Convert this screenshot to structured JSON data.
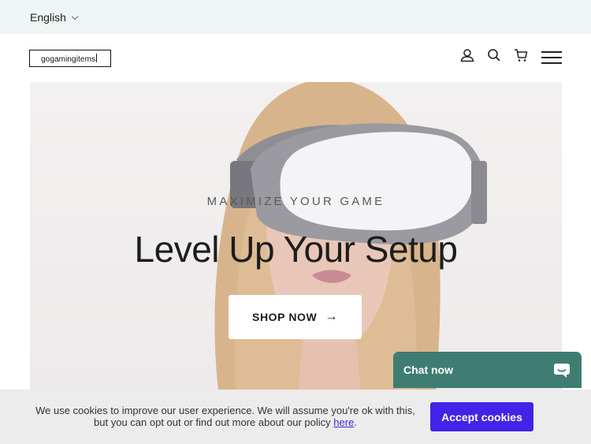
{
  "topbar": {
    "language": "English"
  },
  "header": {
    "logo_text": "gogamingitems",
    "icons": [
      "account-icon",
      "search-icon",
      "cart-icon",
      "menu-icon"
    ]
  },
  "hero": {
    "kicker": "MAXIMIZE YOUR GAME",
    "headline": "Level Up Your Setup",
    "cta_label": "SHOP NOW",
    "cta_icon": "arrow-right-icon",
    "arrow_glyph": "→"
  },
  "chat": {
    "label": "Chat now",
    "icon": "chat-bubble-icon"
  },
  "cookie": {
    "message": "We use cookies to improve our user experience. We will assume you're ok with this, but you can opt out or find out more about our policy",
    "link_label": "here",
    "accept_label": "Accept cookies"
  },
  "colors": {
    "topbar_bg": "#eef5f5",
    "chat_bg": "#3f7d72",
    "accept_bg": "#4323e8",
    "cookie_bg": "#ececec"
  }
}
